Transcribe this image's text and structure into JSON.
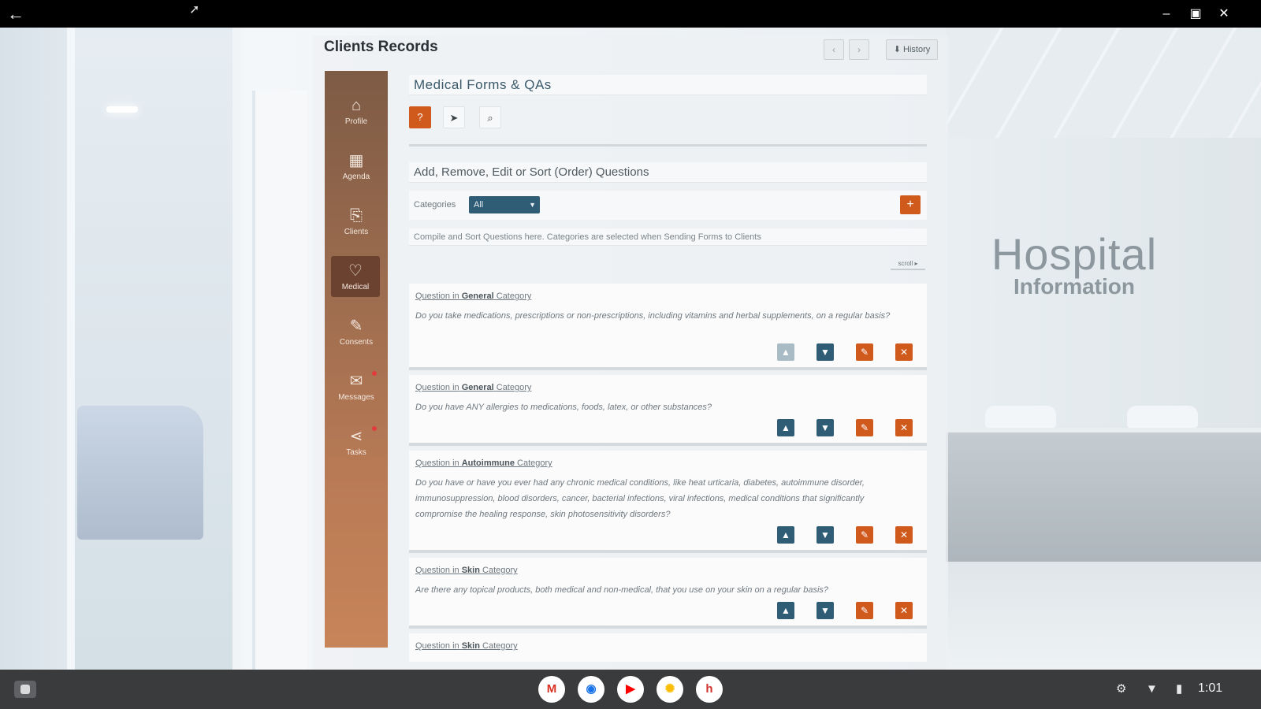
{
  "window": {
    "back_icon": "arrow-left-icon",
    "minimize_icon": "minimize-icon",
    "maximize_icon": "maximize-icon",
    "close_icon": "close-icon"
  },
  "background": {
    "brand_line1": "Hospital",
    "brand_line2": "Information"
  },
  "app": {
    "title": "Clients Records",
    "prev_label": "‹",
    "next_label": "›",
    "history_label": "⬇ History",
    "accent_color": "#cf5a1c",
    "primary_color": "#2e5d75"
  },
  "sidebar": {
    "items": [
      {
        "label": "Profile",
        "icon": "⌂"
      },
      {
        "label": "Agenda",
        "icon": "▦"
      },
      {
        "label": "Clients",
        "icon": "⎘"
      },
      {
        "label": "Medical",
        "icon": "♡"
      },
      {
        "label": "Consents",
        "icon": "✎"
      },
      {
        "label": "Messages",
        "icon": "✉"
      },
      {
        "label": "Tasks",
        "icon": "⋖"
      }
    ]
  },
  "main": {
    "section_title": "Medical Forms & QAs",
    "tools": {
      "help": "?",
      "send": "➤",
      "search": "⌕"
    },
    "subtitle": "Add, Remove, Edit or Sort (Order) Questions",
    "categories_label": "Categories",
    "category_selected": "All",
    "add_label": "+",
    "note": "Compile and Sort Questions here. Categories are selected when Sending Forms to Clients",
    "scroll_label": "scroll ▸",
    "questions": [
      {
        "prefix": "Question in",
        "category": "General",
        "suffix": "Category",
        "text": "Do you take medications, prescriptions or non-prescriptions, including vitamins and herbal supplements, on a regular basis?"
      },
      {
        "prefix": "Question in",
        "category": "General",
        "suffix": "Category",
        "text": "Do you have ANY allergies to medications, foods, latex, or other substances?"
      },
      {
        "prefix": "Question in",
        "category": "Autoimmune",
        "suffix": "Category",
        "text": "Do you have or have you ever had any chronic medical conditions, like heat urticaria, diabetes, autoimmune disorder, immunosuppression, blood disorders, cancer, bacterial infections, viral infections, medical conditions that significantly compromise the healing response, skin photosensitivity disorders?"
      },
      {
        "prefix": "Question in",
        "category": "Skin",
        "suffix": "Category",
        "text": "Are there any topical products, both medical and non-medical, that you use on your skin on a regular basis?"
      },
      {
        "prefix": "Question in",
        "category": "Skin",
        "suffix": "Category",
        "text": ""
      }
    ],
    "action_labels": {
      "up": "▲",
      "down": "▼",
      "edit": "✎",
      "delete": "✕"
    }
  },
  "shelf": {
    "apps": [
      {
        "name": "Gmail",
        "glyph": "M",
        "color": "#d93025"
      },
      {
        "name": "Chrome",
        "glyph": "◉",
        "color": "#1a73e8"
      },
      {
        "name": "YouTube",
        "glyph": "▶",
        "color": "#ff0000"
      },
      {
        "name": "Photos",
        "glyph": "✺",
        "color": "#fbbc04"
      },
      {
        "name": "Hospital app",
        "glyph": "h",
        "color": "#d0342c"
      }
    ],
    "time": "1:01"
  }
}
